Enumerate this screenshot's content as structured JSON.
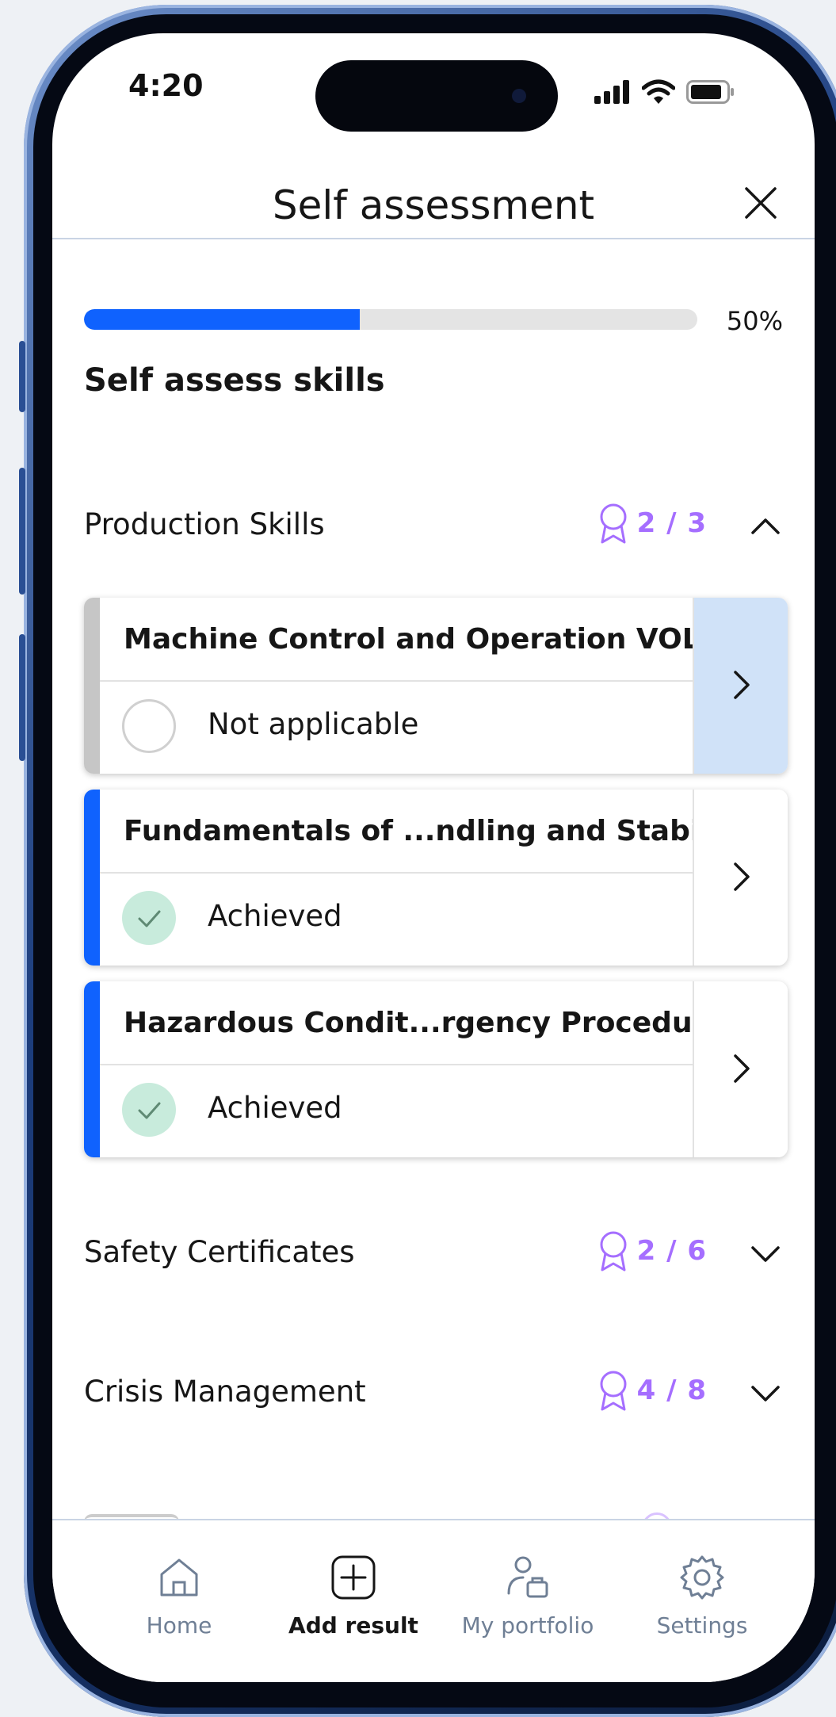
{
  "status_bar": {
    "time": "4:20"
  },
  "header": {
    "title": "Self assessment"
  },
  "progress": {
    "percent_label": "50%",
    "fill_fraction": 0.45
  },
  "section_title": "Self assess skills",
  "categories": [
    {
      "label": "Production Skills",
      "count": "2 / 3",
      "expanded": true
    },
    {
      "label": "Safety Certificates",
      "count": "2 / 6",
      "expanded": false
    },
    {
      "label": "Crisis Management",
      "count": "4 / 8",
      "expanded": false
    }
  ],
  "cards": [
    {
      "title": "Machine Control and Operation VOL. II",
      "status": "Not applicable",
      "accent": "#c6c6c6",
      "go_bg": "#d0e2f8"
    },
    {
      "title": "Fundamentals of ...ndling and Stability",
      "status": "Achieved",
      "accent": "#0f62fe",
      "go_bg": "#ffffff"
    },
    {
      "title": "Hazardous Condit...rgency Procedures",
      "status": "Achieved",
      "accent": "#0f62fe",
      "go_bg": "#ffffff"
    }
  ],
  "tabs": [
    {
      "label": "Home",
      "icon": "home-icon"
    },
    {
      "label": "Add result",
      "icon": "add-icon"
    },
    {
      "label": "My portfolio",
      "icon": "portfolio-icon"
    },
    {
      "label": "Settings",
      "icon": "gear-icon"
    }
  ],
  "colors": {
    "accent": "#0f62fe",
    "badge": "#a56eff",
    "achieved_bg": "#c8ebdc"
  }
}
